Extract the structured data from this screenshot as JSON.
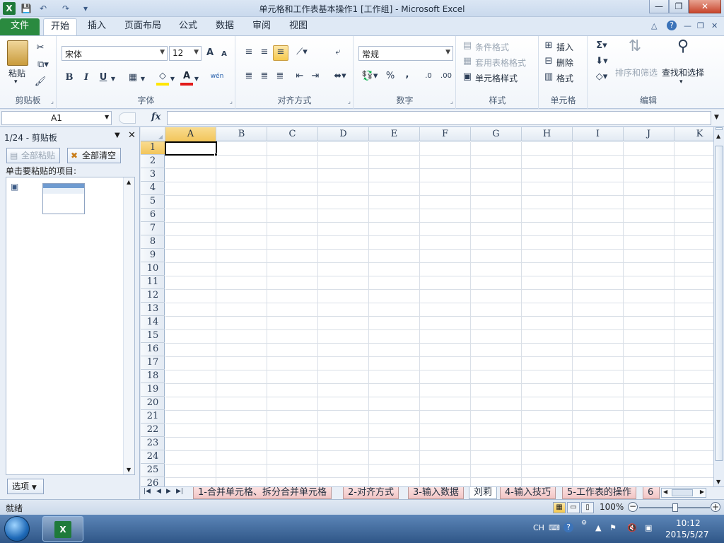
{
  "app": {
    "icon": "X",
    "title": "单元格和工作表基本操作1  [工作组]  -  Microsoft Excel"
  },
  "qat": {
    "save": "💾",
    "undo": "↶",
    "redo": "↷",
    "more": "▾"
  },
  "window": {
    "minimize": "—",
    "restore": "❐",
    "close": "✕"
  },
  "tabs": [
    "文件",
    "开始",
    "插入",
    "页面布局",
    "公式",
    "数据",
    "审阅",
    "视图"
  ],
  "tab_controls": [
    "△",
    "?",
    "—",
    "❐",
    "✕"
  ],
  "ribbon": {
    "clipboard": {
      "label": "剪贴板",
      "paste": "粘贴"
    },
    "font": {
      "label": "字体",
      "name": "宋体",
      "size": "12",
      "grow": "A",
      "shrink": "A",
      "bold": "B",
      "italic": "I",
      "underline": "U",
      "border": "▦",
      "fill": "◇",
      "color": "A",
      "phonetic": "wén"
    },
    "align": {
      "label": "对齐方式"
    },
    "number": {
      "label": "数字",
      "format": "常规",
      "currency": "💱",
      "percent": "%",
      "comma": ",",
      "inc": ".0",
      "dec": ".00"
    },
    "styles": {
      "label": "样式",
      "cond": "条件格式",
      "table": "套用表格格式",
      "cell": "单元格样式"
    },
    "cells": {
      "label": "单元格",
      "insert": "插入",
      "delete": "删除",
      "format": "格式"
    },
    "editing": {
      "label": "编辑",
      "sum": "Σ",
      "sort": "排序和筛选",
      "find": "查找和选择"
    }
  },
  "formula": {
    "namebox": "A1",
    "fx": "fx",
    "value": ""
  },
  "pane": {
    "title": "1/24 - 剪贴板",
    "paste_all": "全部粘贴",
    "clear_all": "全部清空",
    "hint": "单击要粘贴的项目:",
    "options": "选项"
  },
  "grid": {
    "columns": [
      "A",
      "B",
      "C",
      "D",
      "E",
      "F",
      "G",
      "H",
      "I",
      "J",
      "K"
    ],
    "rows": [
      "1",
      "2",
      "3",
      "4",
      "5",
      "6",
      "7",
      "8",
      "9",
      "10",
      "11",
      "12",
      "13",
      "14",
      "15",
      "16",
      "17",
      "18",
      "19",
      "20",
      "21",
      "22",
      "23",
      "24",
      "25",
      "26"
    ],
    "active": "A1"
  },
  "sheets": [
    "1-合并单元格、拆分合并单元格",
    "2-对齐方式",
    "3-输入数据",
    "刘莉",
    "4-输入技巧",
    "5-工作表的操作",
    "6"
  ],
  "status": {
    "text": "就绪",
    "zoom": "100%",
    "zoom_out": "−",
    "zoom_in": "+"
  },
  "taskbar": {
    "lang": "CH",
    "time": "10:12",
    "date": "2015/5/27"
  },
  "colors": {
    "accent": "#2a8a3f",
    "selection": "#f2c55a"
  }
}
